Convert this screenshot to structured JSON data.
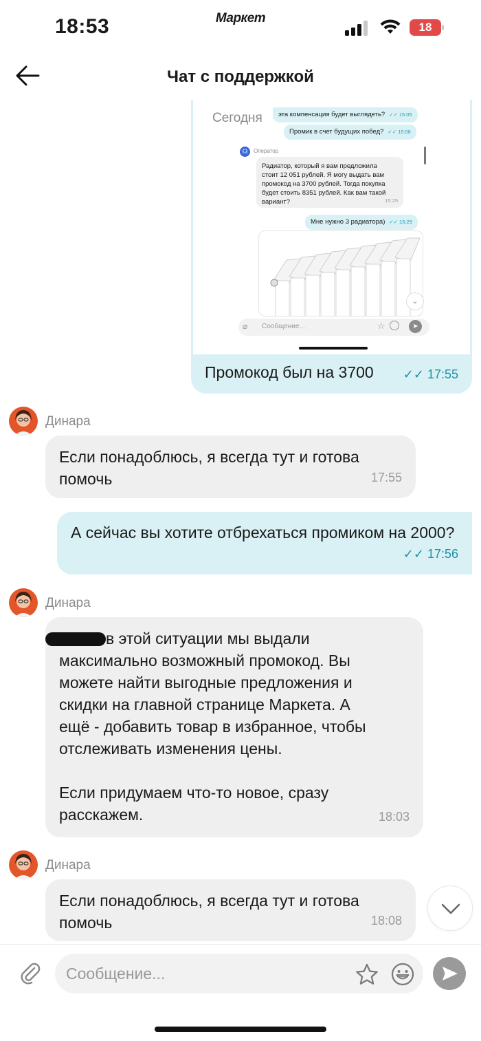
{
  "status_bar": {
    "time": "18:53",
    "app_name": "Маркет",
    "battery": "18",
    "battery_color": "#e24a4a"
  },
  "header": {
    "title": "Чат с поддержкой",
    "back_icon": "arrow-left-icon"
  },
  "forwarded_screenshot": {
    "date_label": "Сегодня",
    "messages": [
      {
        "text": "эта компенсация будет выглядеть?",
        "time": "15:05"
      },
      {
        "text": "Промик в счет будущих побед?",
        "time": "15:06"
      },
      {
        "text": "Мне нужно 3 радиатора)",
        "time": "15:29"
      }
    ],
    "operator": {
      "name": "Оператор",
      "lines": [
        "Радиатор, который я вам предложила",
        "стоит 12 051 рублей. Я могу выдать вам",
        "промокод на 3700 рублей. Тогда покупка",
        "будет стоить 8351 рублей. Как вам такой",
        "вариант?"
      ],
      "time": "15:25"
    },
    "input_placeholder": "Сообщение...",
    "caption": "Промокод был на 3700",
    "caption_time": "17:55"
  },
  "messages": [
    {
      "sender": "Динара",
      "text": "Если понадоблюсь, я всегда тут и готова помочь",
      "time": "17:55"
    },
    {
      "text": "А сейчас вы хотите отбрехаться промиком на 2000?",
      "time": "17:56"
    },
    {
      "sender": "Динара",
      "text_lines": [
        "в этой ситуации мы выдали",
        "максимально возможный промокод. Вы",
        "можете найти выгодные предложения и",
        "скидки на главной странице Маркета. А",
        "ещё - добавить товар в избранное, чтобы",
        "отслеживать изменения цены.",
        "Если придумаем что-то новое, сразу",
        "расскажем."
      ],
      "time": "18:03"
    },
    {
      "sender": "Динара",
      "text": "Если понадоблюсь, я всегда тут и готова помочь",
      "time": "18:08"
    }
  ],
  "composer": {
    "placeholder": "Сообщение...",
    "icons": [
      "paperclip-icon",
      "star-icon",
      "emoji-icon",
      "send-icon",
      "chevron-down-icon"
    ]
  },
  "colors": {
    "outgoing_bubble": "#d9f1f4",
    "incoming_bubble": "#efefef",
    "read_check": "#1d8fa6"
  }
}
